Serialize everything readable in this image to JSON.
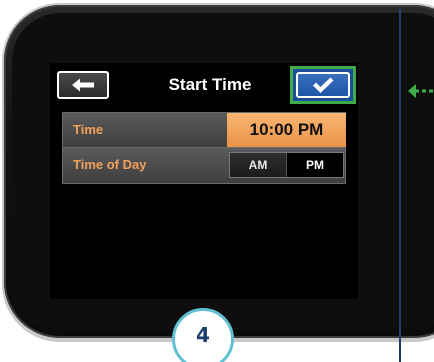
{
  "screen": {
    "title": "Start Time",
    "back_icon": "arrow-left-icon",
    "confirm_icon": "checkmark-icon"
  },
  "rows": [
    {
      "label": "Time",
      "value": "10:00 PM"
    },
    {
      "label": "Time of Day",
      "options": [
        "AM",
        "PM"
      ],
      "selected": "PM"
    }
  ],
  "annotation": {
    "step_number": "4",
    "pointer_icon": "arrow-left-icon",
    "highlight_color": "#3fae49"
  },
  "colors": {
    "accent_orange": "#f3a15a",
    "confirm_blue": "#1f56a8",
    "badge_border": "#5fbfd3",
    "badge_text": "#1b3f6e"
  }
}
